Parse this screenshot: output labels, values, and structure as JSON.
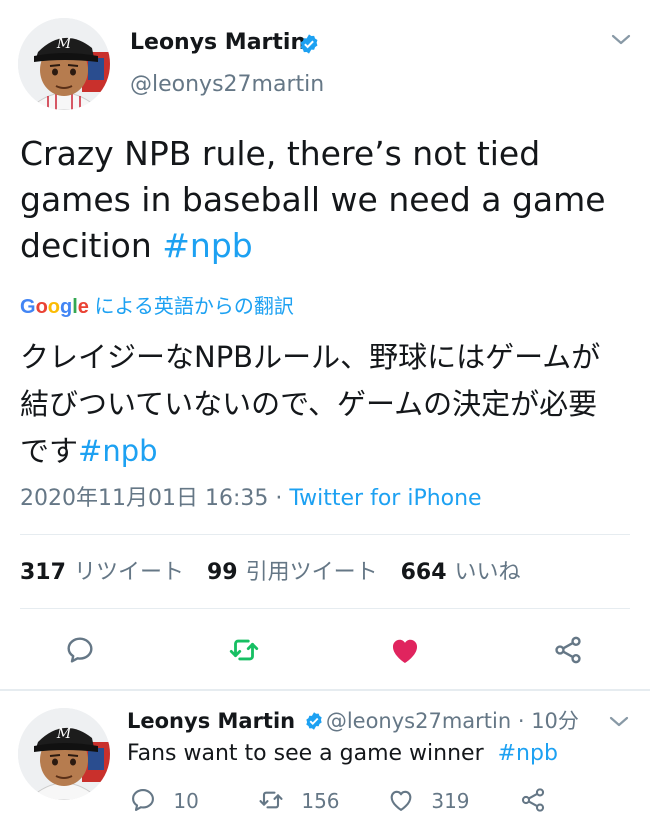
{
  "main_tweet": {
    "author_name": "Leonys Martin",
    "handle": "@leonys27martin",
    "text_line1": "Crazy NPB rule, there’s not tied",
    "text_line2": "games in baseball we need a game",
    "text_line3_prefix": "decition ",
    "hashtag": "#npb",
    "translation_provider": "Google",
    "translation_suffix": "による英語からの翻訳",
    "translated_line1": "クレイジーなNPBルール、野球にはゲームが",
    "translated_line2": "結びついていないので、ゲームの決定が必要",
    "translated_line3_prefix": "です",
    "translated_hashtag": "#npb",
    "timestamp": "2020年11月01日 16:35",
    "separator": " · ",
    "source": "Twitter for iPhone",
    "retweets_count": "317",
    "retweets_label": "リツイート",
    "quotes_count": "99",
    "quotes_label": "引用ツイート",
    "likes_count": "664",
    "likes_label": "いいね"
  },
  "reply_tweet": {
    "author_name": "Leonys Martin",
    "handle": "@leonys27martin",
    "time_sep": " · ",
    "time": "10分",
    "text_prefix": "Fans want to see a game winner  ",
    "hashtag": "#npb",
    "reply_count": "10",
    "retweet_count": "156",
    "like_count": "319"
  },
  "colors": {
    "accent": "#1da1f2",
    "retweet_green": "#17bf63",
    "like_red": "#e0245e",
    "muted": "#657786"
  },
  "icons": [
    "verified-badge-icon",
    "chevron-down-icon",
    "reply-icon",
    "retweet-icon",
    "heart-icon",
    "share-icon"
  ]
}
